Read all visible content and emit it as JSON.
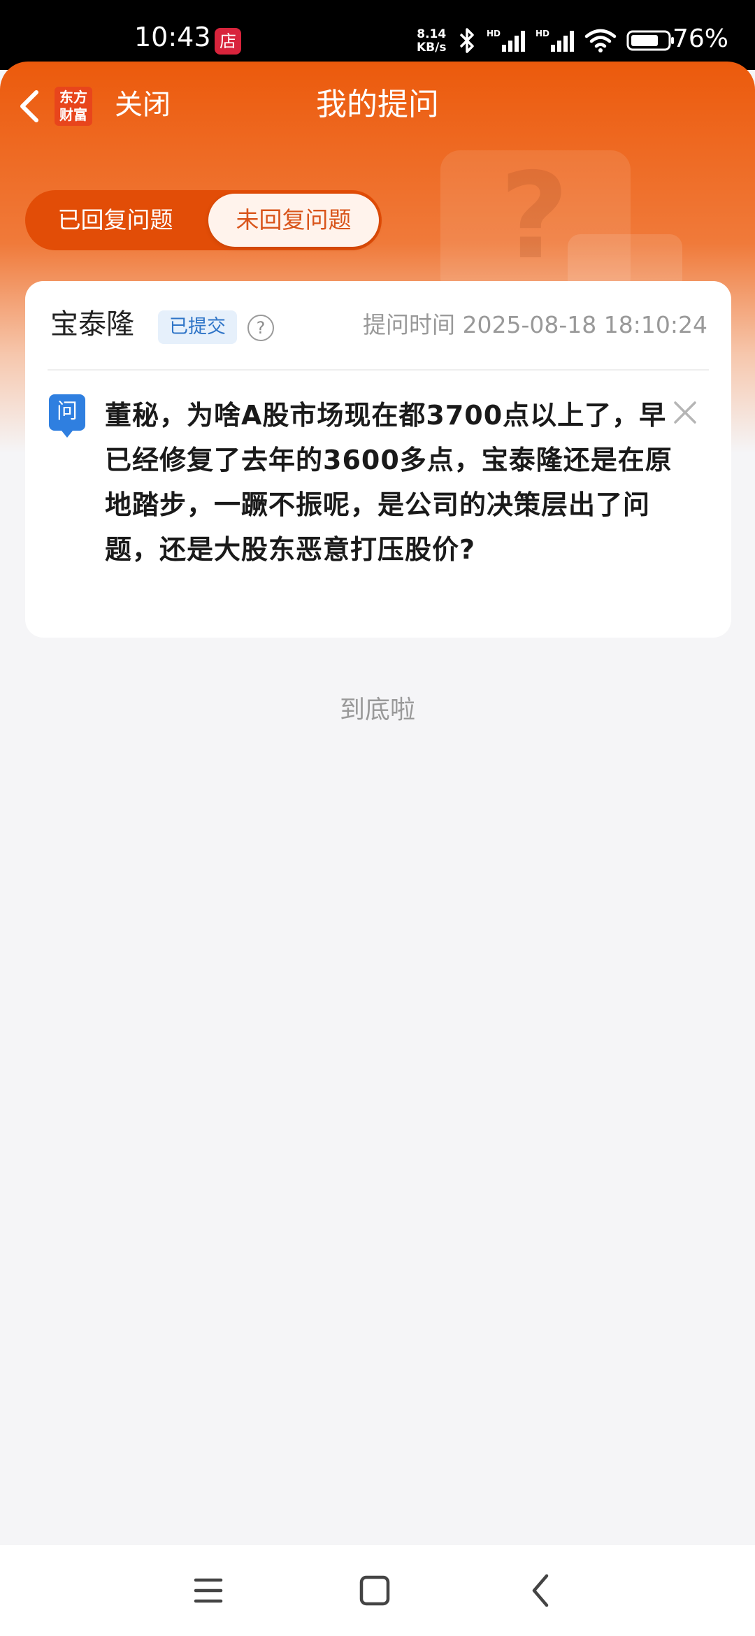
{
  "status_bar": {
    "time": "10:43",
    "app_badge": "店",
    "net_speed_value": "8.14",
    "net_speed_unit": "KB/s",
    "battery": "76%",
    "icons": [
      "bluetooth-icon",
      "hd-signal-icon",
      "hd-signal-icon",
      "wifi-icon",
      "battery-icon"
    ]
  },
  "header": {
    "back_icon": "chevron-left-icon",
    "brand_line1": "东方",
    "brand_line2": "财富",
    "close_label": "关闭",
    "title": "我的提问"
  },
  "tabs": [
    {
      "label": "已回复问题",
      "active": false
    },
    {
      "label": "未回复问题",
      "active": true
    }
  ],
  "question": {
    "company": "宝泰隆",
    "status": "已提交",
    "help_icon": "?",
    "time": "提问时间 2025-08-18 18:10:24",
    "q_icon": "问",
    "text": "董秘，为啥A股市场现在都3700点以上了，早已经修复了去年的3600多点，宝泰隆还是在原地踏步，一蹶不振呢，是公司的决策层出了问题，还是大股东恶意打压股价?"
  },
  "end_text": "到底啦",
  "colors": {
    "brand_orange": "#ec5a0c",
    "badge_blue": "#2e74c7",
    "q_icon_blue": "#2f7fe0"
  },
  "system_nav": [
    "menu-icon",
    "home-icon",
    "back-icon"
  ]
}
